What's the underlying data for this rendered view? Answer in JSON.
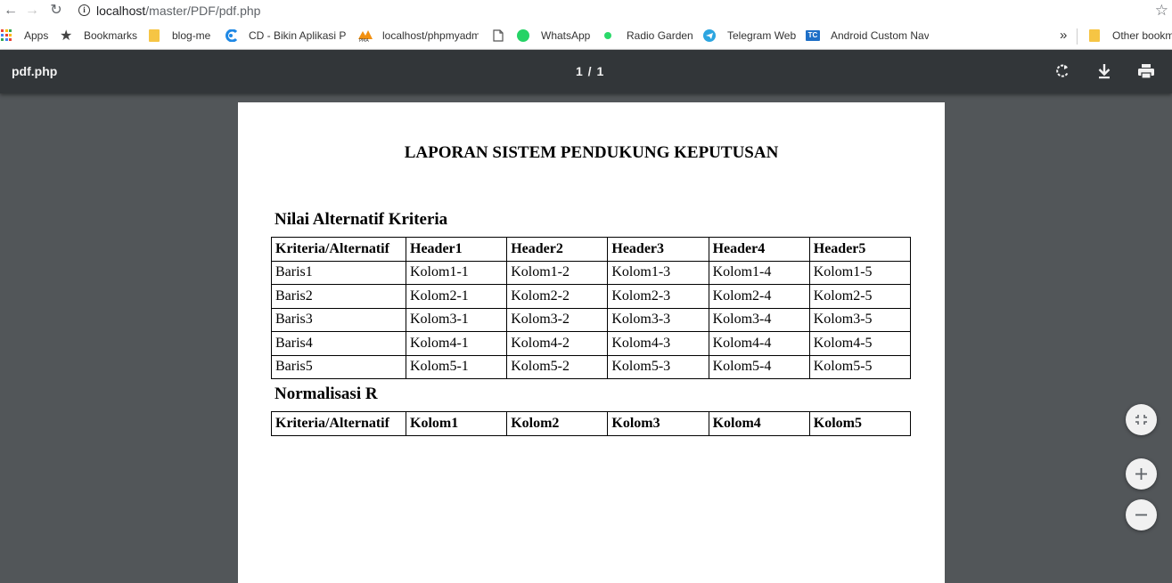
{
  "browser": {
    "url_host": "localhost",
    "url_path": "/master/PDF/pdf.php",
    "bookmarks": [
      {
        "label": "Apps",
        "icon": "apps-grid-icon"
      },
      {
        "label": "Bookmarks",
        "icon": "star-icon"
      },
      {
        "label": "blog-me",
        "icon": "folder-icon"
      },
      {
        "label": "CD - Bikin Aplikasi P",
        "icon": "cd-logo-icon"
      },
      {
        "label": "localhost/phpmyadm",
        "icon": "phpmyadmin-icon"
      },
      {
        "label": "",
        "icon": "page-icon"
      },
      {
        "label": "WhatsApp",
        "icon": "whatsapp-icon"
      },
      {
        "label": "Radio Garden",
        "icon": "radio-garden-icon"
      },
      {
        "label": "Telegram Web",
        "icon": "telegram-icon"
      },
      {
        "label": "Android Custom Nav",
        "icon": "tc-icon"
      }
    ],
    "overflow": "»",
    "other_bookmarks": "Other bookm"
  },
  "pdf_toolbar": {
    "title": "pdf.php",
    "page_indicator": "1 / 1"
  },
  "document": {
    "title": "LAPORAN SISTEM PENDUKUNG KEPUTUSAN",
    "section1": {
      "heading": "Nilai Alternatif Kriteria",
      "headers": [
        "Kriteria/Alternatif",
        "Header1",
        "Header2",
        "Header3",
        "Header4",
        "Header5"
      ],
      "rows": [
        [
          "Baris1",
          "Kolom1-1",
          "Kolom1-2",
          "Kolom1-3",
          "Kolom1-4",
          "Kolom1-5"
        ],
        [
          "Baris2",
          "Kolom2-1",
          "Kolom2-2",
          "Kolom2-3",
          "Kolom2-4",
          "Kolom2-5"
        ],
        [
          "Baris3",
          "Kolom3-1",
          "Kolom3-2",
          "Kolom3-3",
          "Kolom3-4",
          "Kolom3-5"
        ],
        [
          "Baris4",
          "Kolom4-1",
          "Kolom4-2",
          "Kolom4-3",
          "Kolom4-4",
          "Kolom4-5"
        ],
        [
          "Baris5",
          "Kolom5-1",
          "Kolom5-2",
          "Kolom5-3",
          "Kolom5-4",
          "Kolom5-5"
        ]
      ]
    },
    "section2": {
      "heading": "Normalisasi R",
      "headers": [
        "Kriteria/Alternatif",
        "Kolom1",
        "Kolom2",
        "Kolom3",
        "Kolom4",
        "Kolom5"
      ]
    }
  },
  "colors": {
    "viewer_bg": "#525659",
    "toolbar_bg": "#323639",
    "whatsapp": "#25d366",
    "telegram": "#2ca5e0"
  }
}
